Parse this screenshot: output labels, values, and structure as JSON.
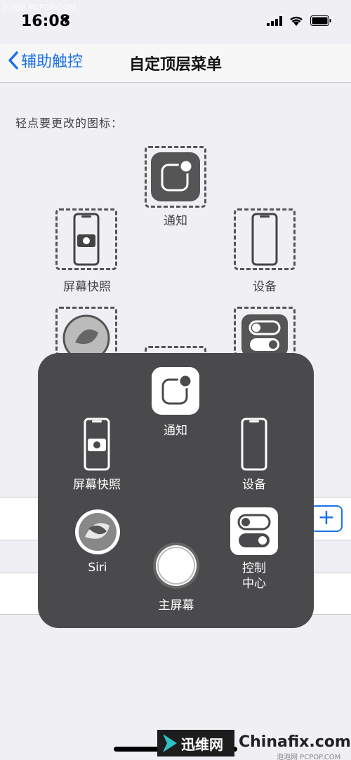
{
  "watermark": {
    "top": "泡泡网 PCPOP.COM",
    "bottom_logo": "迅维网",
    "bottom_site": "Chinafix.com",
    "bottom_sub": "泡泡网 PCPOP.COM"
  },
  "status_bar": {
    "time": "16:08",
    "location_icon": "location-arrow-icon",
    "signal_icon": "cellular-signal-icon",
    "wifi_icon": "wifi-icon",
    "battery_icon": "battery-icon"
  },
  "nav": {
    "back_label": "辅助触控",
    "title": "自定顶层菜单"
  },
  "section": {
    "label": "轻点要更改的图标："
  },
  "slots": {
    "top": {
      "label": "通知",
      "icon": "notification-icon"
    },
    "left": {
      "label": "屏幕快照",
      "icon": "screenshot-icon"
    },
    "right": {
      "label": "设备",
      "icon": "device-icon"
    },
    "siri": {
      "icon": "siri-icon"
    },
    "control": {
      "icon": "control-center-icon"
    }
  },
  "add_button": {
    "label": "+"
  },
  "menu": {
    "items": [
      {
        "label": "通知",
        "icon": "notification-icon"
      },
      {
        "label": "屏幕快照",
        "icon": "screenshot-icon"
      },
      {
        "label": "设备",
        "icon": "device-icon"
      },
      {
        "label": "Siri",
        "icon": "siri-icon"
      },
      {
        "label": "主屏幕",
        "icon": "home-button-icon"
      },
      {
        "label": "控制\n中心",
        "icon": "control-center-icon"
      }
    ]
  },
  "colors": {
    "accent": "#1b72e8",
    "menu_bg": "#4a4a4c",
    "page_bg": "#efeff4"
  }
}
